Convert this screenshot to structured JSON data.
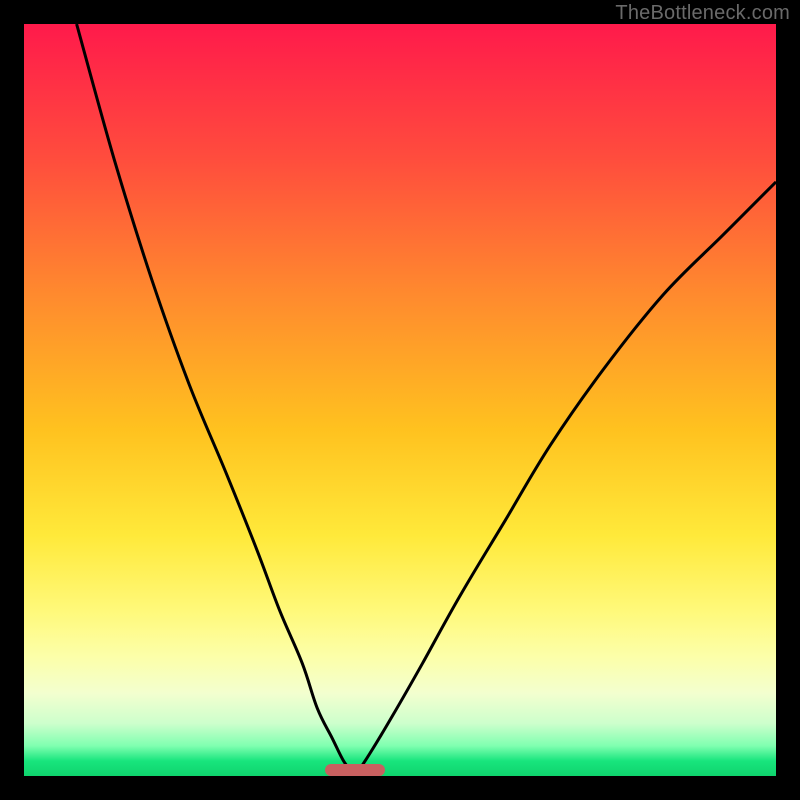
{
  "watermark": "TheBottleneck.com",
  "chart_data": {
    "type": "line",
    "title": "",
    "xlabel": "",
    "ylabel": "",
    "xlim": [
      0,
      100
    ],
    "ylim": [
      0,
      100
    ],
    "grid": false,
    "legend": false,
    "marker": {
      "x_center": 44,
      "width_pct": 8
    },
    "series": [
      {
        "name": "left-curve",
        "x": [
          7,
          12,
          17,
          22,
          27,
          31,
          34,
          37,
          39,
          41,
          42.5,
          44
        ],
        "y": [
          100,
          82,
          66,
          52,
          40,
          30,
          22,
          15,
          9,
          5,
          2,
          0
        ]
      },
      {
        "name": "right-curve",
        "x": [
          44,
          46,
          49,
          53,
          58,
          64,
          70,
          77,
          85,
          93,
          100
        ],
        "y": [
          0,
          3,
          8,
          15,
          24,
          34,
          44,
          54,
          64,
          72,
          79
        ]
      }
    ],
    "gradient_stops": [
      {
        "pct": 0,
        "color": "#ff1a4b"
      },
      {
        "pct": 18,
        "color": "#ff4d3d"
      },
      {
        "pct": 36,
        "color": "#ff8a2e"
      },
      {
        "pct": 54,
        "color": "#ffc21f"
      },
      {
        "pct": 68,
        "color": "#ffe93a"
      },
      {
        "pct": 78,
        "color": "#fff97a"
      },
      {
        "pct": 84,
        "color": "#fcffa8"
      },
      {
        "pct": 89,
        "color": "#f3ffcf"
      },
      {
        "pct": 93,
        "color": "#cdffcc"
      },
      {
        "pct": 96,
        "color": "#7fffb0"
      },
      {
        "pct": 98,
        "color": "#18e57d"
      },
      {
        "pct": 100,
        "color": "#0fd36d"
      }
    ]
  }
}
